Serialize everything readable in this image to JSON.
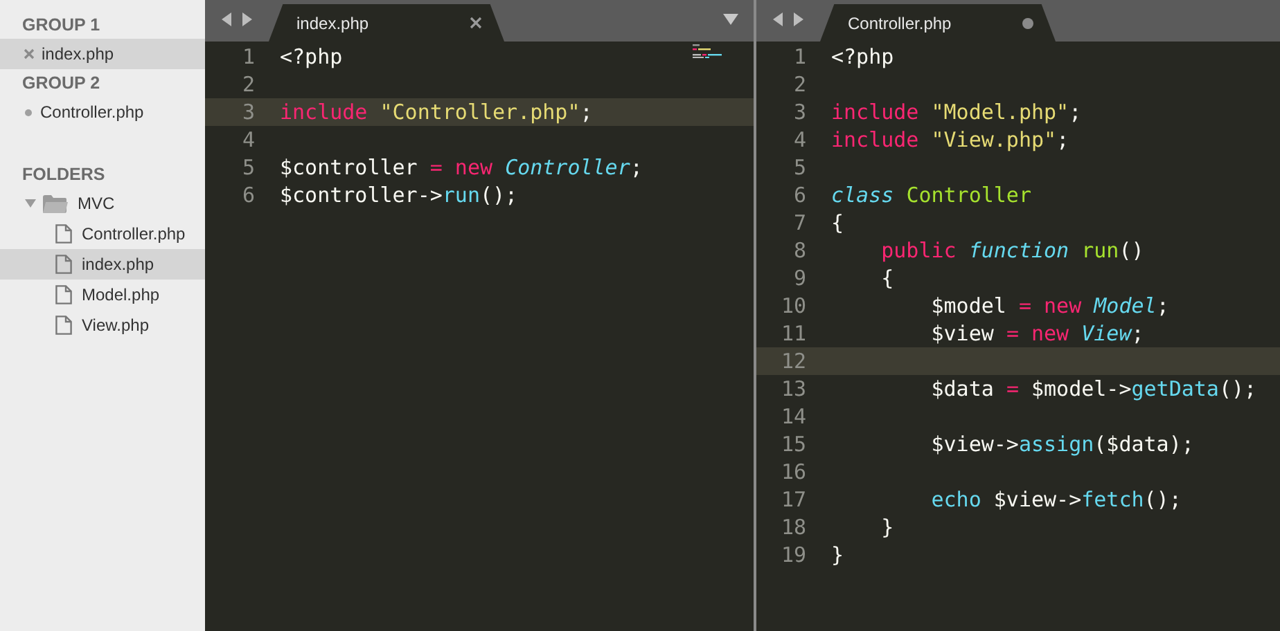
{
  "sidebar": {
    "groups": [
      {
        "title": "GROUP 1",
        "files": [
          {
            "name": "index.php",
            "selected": true,
            "modified": false
          }
        ]
      },
      {
        "title": "GROUP 2",
        "files": [
          {
            "name": "Controller.php",
            "selected": false,
            "modified": true
          }
        ]
      }
    ],
    "folders": {
      "title": "FOLDERS",
      "tree": [
        {
          "name": "MVC",
          "kind": "folder",
          "expanded": true,
          "selected": false,
          "children": [
            {
              "name": "Controller.php",
              "kind": "file",
              "selected": false
            },
            {
              "name": "index.php",
              "kind": "file",
              "selected": true
            },
            {
              "name": "Model.php",
              "kind": "file",
              "selected": false
            },
            {
              "name": "View.php",
              "kind": "file",
              "selected": false
            }
          ]
        }
      ]
    }
  },
  "panes": [
    {
      "tab": {
        "label": "index.php",
        "modified": false
      },
      "minimap": true,
      "lines": [
        {
          "number": "1",
          "current": false,
          "tokens": [
            {
              "text": "<?php",
              "kind": "plain"
            }
          ]
        },
        {
          "number": "2",
          "current": false
        },
        {
          "number": "3",
          "current": true,
          "tokens": [
            {
              "text": "include ",
              "kind": "keyword"
            },
            {
              "text": "\"Controller.php\"",
              "kind": "string"
            },
            {
              "text": ";",
              "kind": "plain"
            }
          ]
        },
        {
          "number": "4",
          "current": false
        },
        {
          "number": "5",
          "current": false,
          "tokens": [
            {
              "text": "$controller ",
              "kind": "plain"
            },
            {
              "text": "= new ",
              "kind": "keyword"
            },
            {
              "text": "Controller",
              "kind": "type"
            },
            {
              "text": ";",
              "kind": "plain"
            }
          ]
        },
        {
          "number": "6",
          "current": false,
          "tokens": [
            {
              "text": "$controller->",
              "kind": "plain"
            },
            {
              "text": "run",
              "kind": "func"
            },
            {
              "text": "();",
              "kind": "plain"
            }
          ]
        }
      ]
    },
    {
      "tab": {
        "label": "Controller.php",
        "modified": true
      },
      "lines": [
        {
          "number": "1",
          "current": false,
          "tokens": [
            {
              "text": "<?php",
              "kind": "plain"
            }
          ]
        },
        {
          "number": "2",
          "current": false
        },
        {
          "number": "3",
          "current": false,
          "tokens": [
            {
              "text": "include ",
              "kind": "keyword"
            },
            {
              "text": "\"Model.php\"",
              "kind": "string"
            },
            {
              "text": ";",
              "kind": "plain"
            }
          ]
        },
        {
          "number": "4",
          "current": false,
          "tokens": [
            {
              "text": "include ",
              "kind": "keyword"
            },
            {
              "text": "\"View.php\"",
              "kind": "string"
            },
            {
              "text": ";",
              "kind": "plain"
            }
          ]
        },
        {
          "number": "5",
          "current": false
        },
        {
          "number": "6",
          "current": false,
          "tokens": [
            {
              "text": "class ",
              "kind": "storage"
            },
            {
              "text": "Controller",
              "kind": "entity"
            }
          ]
        },
        {
          "number": "7",
          "current": false,
          "tokens": [
            {
              "text": "{",
              "kind": "plain"
            }
          ]
        },
        {
          "number": "8",
          "current": false,
          "tokens": [
            {
              "text": "    public ",
              "kind": "keyword"
            },
            {
              "text": "function ",
              "kind": "storage"
            },
            {
              "text": "run",
              "kind": "entity"
            },
            {
              "text": "()",
              "kind": "plain"
            }
          ]
        },
        {
          "number": "9",
          "current": false,
          "tokens": [
            {
              "text": "    {",
              "kind": "plain"
            }
          ]
        },
        {
          "number": "10",
          "current": false,
          "tokens": [
            {
              "text": "        $model ",
              "kind": "plain"
            },
            {
              "text": "= new ",
              "kind": "keyword"
            },
            {
              "text": "Model",
              "kind": "type"
            },
            {
              "text": ";",
              "kind": "plain"
            }
          ]
        },
        {
          "number": "11",
          "current": false,
          "tokens": [
            {
              "text": "        $view ",
              "kind": "plain"
            },
            {
              "text": "= new ",
              "kind": "keyword"
            },
            {
              "text": "View",
              "kind": "type"
            },
            {
              "text": ";",
              "kind": "plain"
            }
          ]
        },
        {
          "number": "12",
          "current": true
        },
        {
          "number": "13",
          "current": false,
          "tokens": [
            {
              "text": "        $data ",
              "kind": "plain"
            },
            {
              "text": "=",
              "kind": "keyword"
            },
            {
              "text": " $model->",
              "kind": "plain"
            },
            {
              "text": "getData",
              "kind": "func"
            },
            {
              "text": "();",
              "kind": "plain"
            }
          ]
        },
        {
          "number": "14",
          "current": false
        },
        {
          "number": "15",
          "current": false,
          "tokens": [
            {
              "text": "        $view->",
              "kind": "plain"
            },
            {
              "text": "assign",
              "kind": "func"
            },
            {
              "text": "($data);",
              "kind": "plain"
            }
          ]
        },
        {
          "number": "16",
          "current": false
        },
        {
          "number": "17",
          "current": false,
          "tokens": [
            {
              "text": "        echo",
              "kind": "func"
            },
            {
              "text": " $view->",
              "kind": "plain"
            },
            {
              "text": "fetch",
              "kind": "func"
            },
            {
              "text": "();",
              "kind": "plain"
            }
          ]
        },
        {
          "number": "18",
          "current": false,
          "tokens": [
            {
              "text": "    }",
              "kind": "plain"
            }
          ]
        },
        {
          "number": "19",
          "current": false,
          "tokens": [
            {
              "text": "}",
              "kind": "plain"
            }
          ]
        }
      ]
    }
  ]
}
